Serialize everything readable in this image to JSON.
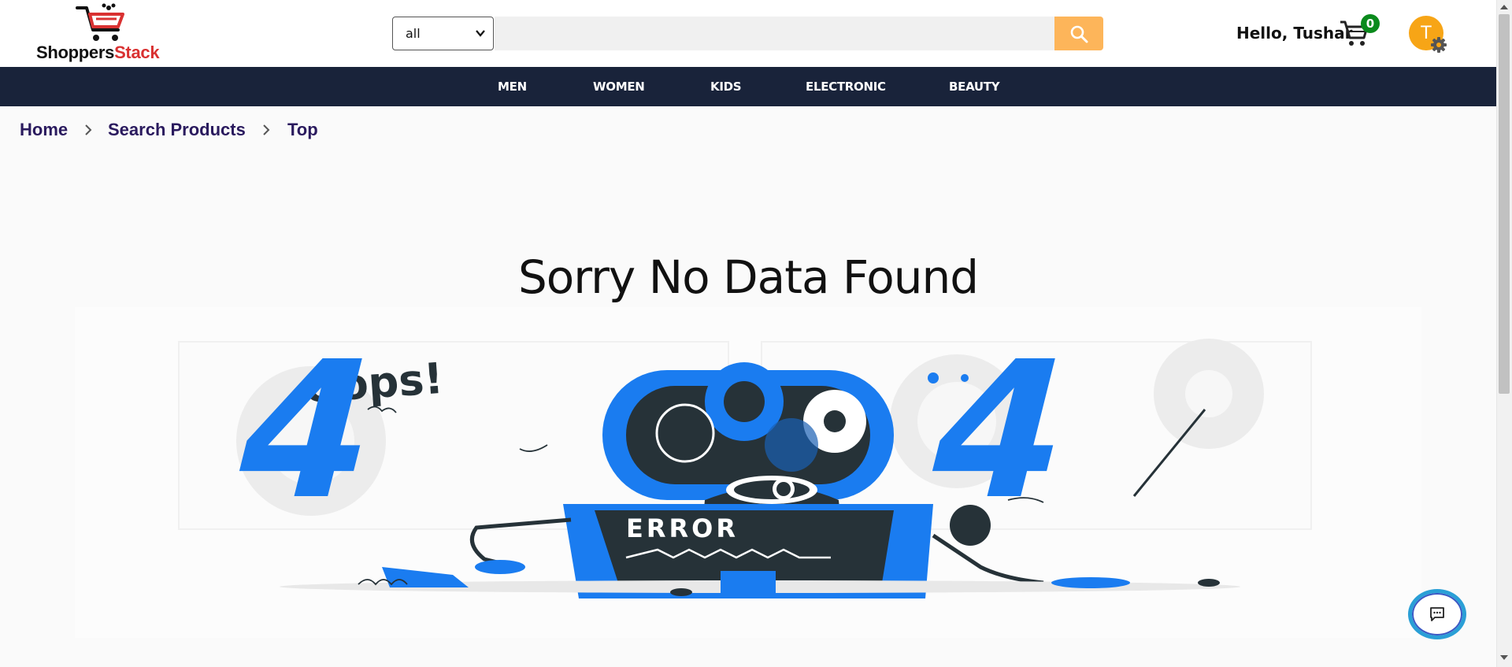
{
  "brand": {
    "name_part1": "Shoppers",
    "name_part2": "Stack",
    "accent_color": "#d93131"
  },
  "search": {
    "category_selected": "all",
    "placeholder": "",
    "value": "",
    "button_color": "#fdb55a",
    "button_icon": "search-icon"
  },
  "user": {
    "greeting": "Hello, Tushar",
    "cart_count": "0",
    "avatar_initial": "T",
    "avatar_color": "#f7a516"
  },
  "nav": {
    "background": "#19233a",
    "items": [
      {
        "label": "MEN"
      },
      {
        "label": "WOMEN"
      },
      {
        "label": "KIDS"
      },
      {
        "label": "ELECTRONIC"
      },
      {
        "label": "BEAUTY"
      }
    ]
  },
  "breadcrumb": {
    "items": [
      {
        "label": "Home"
      },
      {
        "label": "Search Products"
      },
      {
        "label": "Top"
      }
    ]
  },
  "main": {
    "title": "Sorry No Data Found",
    "illustration": {
      "oops_text": "Oops!",
      "digit_left": "4",
      "digit_right": "4",
      "error_label": "ERROR",
      "primary_color": "#1a7cf0",
      "dark_color": "#263238"
    }
  },
  "chat": {
    "icon": "chat-icon"
  }
}
